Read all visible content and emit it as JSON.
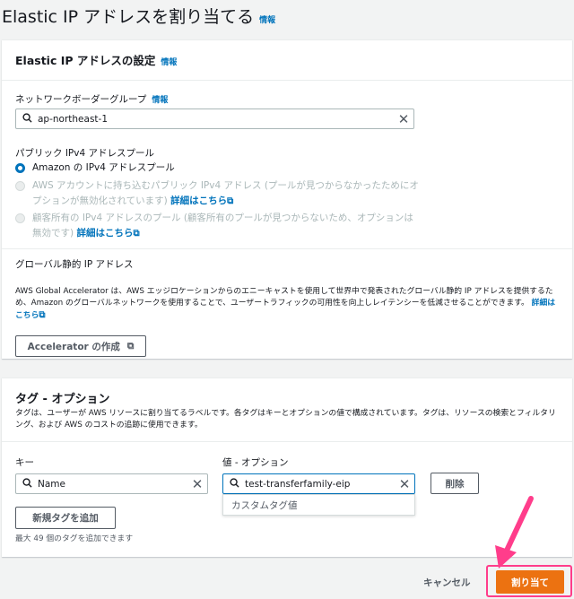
{
  "page": {
    "title": "Elastic IP アドレスを割り当てる",
    "info": "情報"
  },
  "settings": {
    "header": "Elastic IP アドレスの設定",
    "info": "情報",
    "network_border_group": {
      "label": "ネットワークボーダーグループ",
      "info": "情報",
      "value": "ap-northeast-1"
    },
    "pool": {
      "label": "パブリック IPv4 アドレスプール",
      "options": [
        {
          "text": "Amazon の IPv4 アドレスプール",
          "selected": true,
          "disabled": false
        },
        {
          "text": "AWS アカウントに持ち込むパブリック IPv4 アドレス (プールが見つからなかったためにオプションが無効化されています)",
          "link": "詳細はこちら",
          "selected": false,
          "disabled": true
        },
        {
          "text": "顧客所有の IPv4 アドレスのプール (顧客所有のプールが見つからないため、オプションは無効です)",
          "link": "詳細はこちら",
          "selected": false,
          "disabled": true
        }
      ]
    },
    "global": {
      "label": "グローバル静的 IP アドレス",
      "description": "AWS Global Accelerator は、AWS エッジロケーションからのエニーキャストを使用して世界中で発表されたグローバル静的 IP アドレスを提供するため、Amazon のグローバルネットワークを使用することで、ユーザートラフィックの可用性を向上しレイテンシーを低減させることができます。",
      "link": "詳細はこちら",
      "button": "Accelerator の作成"
    }
  },
  "tags": {
    "header": "タグ - オプション",
    "description": "タグは、ユーザーが AWS リソースに割り当てるラベルです。各タグはキーとオプションの値で構成されています。タグは、リソースの検索とフィルタリング、および AWS のコストの追跡に使用できます。",
    "key_label": "キー",
    "value_label": "値 - オプション",
    "key_value": "Name",
    "value_value": "test-transferfamily-eip",
    "dropdown_option": "カスタムタグ値",
    "remove_button": "削除",
    "add_button": "新規タグを追加",
    "limit_text": "最大 49 個のタグを追加できます"
  },
  "footer": {
    "cancel": "キャンセル",
    "submit": "割り当て"
  },
  "colors": {
    "primary": "#ec7211",
    "link": "#0073bb",
    "annotation": "#ff3d8b"
  }
}
